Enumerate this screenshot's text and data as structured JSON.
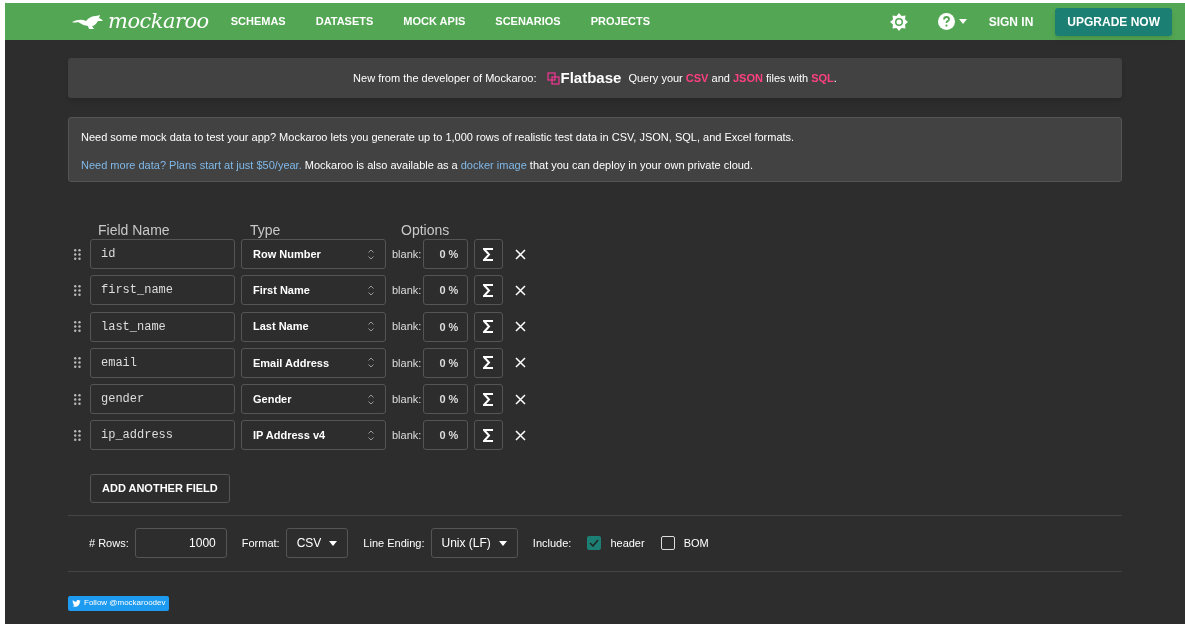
{
  "nav": {
    "logo": "mockaroo",
    "items": [
      {
        "label": "SCHEMAS"
      },
      {
        "label": "DATASETS"
      },
      {
        "label": "MOCK APIS"
      },
      {
        "label": "SCENARIOS"
      },
      {
        "label": "PROJECTS"
      }
    ],
    "sign_in": "SIGN IN",
    "upgrade": "UPGRADE NOW"
  },
  "banner": {
    "lead": "New from the developer of Mockaroo:",
    "brand": "Flatbase",
    "tagline": "Query your **CSV** and **JSON** files with **SQL**."
  },
  "info": {
    "line1": "Need some mock data to test your app? Mockaroo lets you generate up to 1,000 rows of realistic test data in CSV, JSON, SQL, and Excel formats.",
    "link1": "Need more data? Plans start at just $50/year.",
    "text2": "Mockaroo is also available as a",
    "link2": "docker image",
    "text3": "that you can deploy in your own private cloud."
  },
  "columns": [
    "Field Name",
    "Type",
    "Options"
  ],
  "fields": [
    {
      "name": "id",
      "type": "Row Number",
      "blank_label": "blank:",
      "blank": "0 %"
    },
    {
      "name": "first_name",
      "type": "First Name",
      "blank_label": "blank:",
      "blank": "0 %"
    },
    {
      "name": "last_name",
      "type": "Last Name",
      "blank_label": "blank:",
      "blank": "0 %"
    },
    {
      "name": "email",
      "type": "Email Address",
      "blank_label": "blank:",
      "blank": "0 %"
    },
    {
      "name": "gender",
      "type": "Gender",
      "blank_label": "blank:",
      "blank": "0 %"
    },
    {
      "name": "ip_address",
      "type": "IP Address v4",
      "blank_label": "blank:",
      "blank": "0 %"
    }
  ],
  "add_button": "ADD ANOTHER FIELD",
  "options": {
    "rows_label": "# Rows:",
    "rows": "1000",
    "format_label": "Format:",
    "format": "CSV",
    "line_ending_label": "Line Ending:",
    "line_ending": "Unix (LF)",
    "include_label": "Include:",
    "include": [
      {
        "label": "header",
        "checked": true
      },
      {
        "label": "BOM",
        "checked": false
      }
    ]
  },
  "follow": "Follow @mockaroodev"
}
